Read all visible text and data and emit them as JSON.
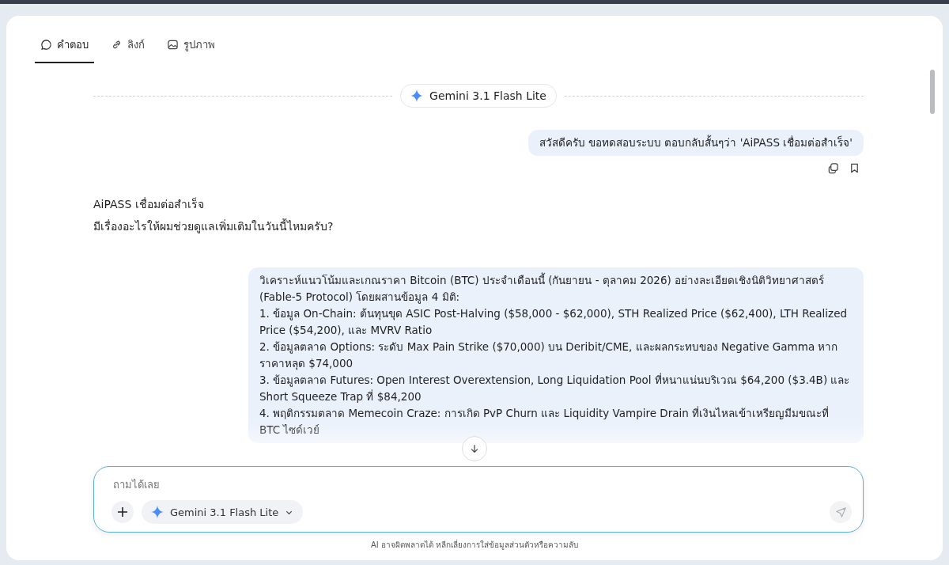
{
  "tabs": [
    {
      "label": "คำตอบ",
      "selected": true
    },
    {
      "label": "ลิงก์",
      "selected": false
    },
    {
      "label": "รูปภาพ",
      "selected": false
    }
  ],
  "model_divider": {
    "label": "Gemini 3.1 Flash Lite"
  },
  "messages": [
    {
      "kind": "user",
      "paragraphs": [
        "สวัสดีครับ ขอทดสอบระบบ ตอบกลับสั้นๆว่า 'AiPASS เชื่อมต่อสำเร็จ'"
      ],
      "actions": true
    },
    {
      "kind": "model",
      "paragraphs": [
        "AiPASS เชื่อมต่อสำเร็จ",
        "มีเรื่องอะไรให้ผมช่วยดูแลเพิ่มเติมในวันนี้ไหมครับ?"
      ],
      "actions": false
    },
    {
      "kind": "user",
      "paragraphs": [
        "วิเคราะห์แนวโน้มและเกณราคา Bitcoin (BTC) ประจำเดือนนี้ (กันยายน - ตุลาคม 2026) อย่างละเอียดเชิงนิติวิทยาศาสตร์ (Fable-5 Protocol) โดยผสานข้อมูล 4 มิติ:",
        "1. ข้อมูล On-Chain: ต้นทุนขุด ASIC Post-Halving ($58,000 - $62,000), STH Realized Price ($62,400), LTH Realized Price ($54,200), และ MVRV Ratio",
        "2. ข้อมูลตลาด Options: ระดับ Max Pain Strike ($70,000) บน Deribit/CME, และผลกระทบของ Negative Gamma หากราคาหลุด $74,000",
        "3. ข้อมูลตลาด Futures: Open Interest Overextension, Long Liquidation Pool ที่หนาแน่นบริเวณ $64,200 ($3.4B) และ Short Squeeze Trap ที่ $84,200",
        "4. พฤติกรรมตลาด Memecoin Craze: การเกิด PvP Churn และ Liquidity Vampire Drain ที่เงินไหลเข้าเหรียญมีมขณะที่ BTC ไซด์เวย์"
      ],
      "actions": false
    }
  ],
  "composer": {
    "placeholder": "ถามได้เลย",
    "model": "Gemini 3.1 Flash Lite"
  },
  "disclaimer": "AI อาจผิดพลาดได้ หลีกเลี่ยงการใส่ข้อมูลส่วนตัวหรือความลับ"
}
